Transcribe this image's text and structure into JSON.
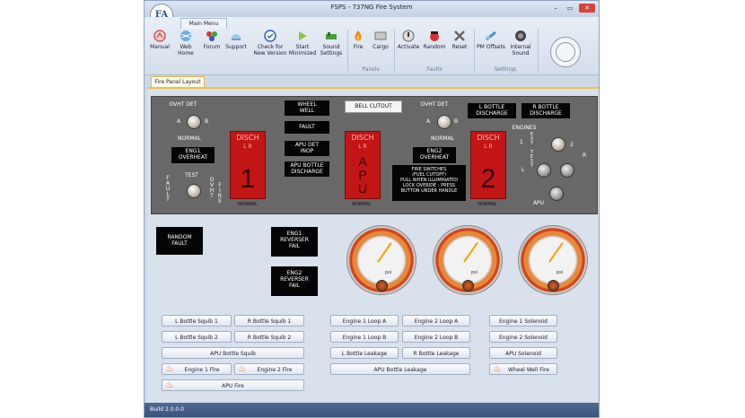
{
  "window": {
    "title": "FSPS - 737NG Fire System",
    "logo_text": "FA",
    "controls": {
      "minimize": "–",
      "maximize": "▭",
      "close": "✕"
    }
  },
  "ribbon": {
    "tab": "Main Menu",
    "buttons": [
      {
        "label": "Manual",
        "icon": "manual-icon"
      },
      {
        "label": "Web Home",
        "icon": "web-home-icon"
      },
      {
        "label": "Forum",
        "icon": "forum-icon"
      },
      {
        "label": "Support",
        "icon": "support-icon"
      },
      {
        "label": "Check for\nNew Version",
        "icon": "check-version-icon"
      },
      {
        "label": "Start\nMinimized",
        "icon": "start-minimized-icon"
      },
      {
        "label": "Sound\nSettings",
        "icon": "sound-settings-icon"
      },
      {
        "label": "Fire",
        "icon": "fire-icon"
      },
      {
        "label": "Cargo",
        "icon": "cargo-icon"
      },
      {
        "label": "Activate",
        "icon": "activate-icon"
      },
      {
        "label": "Random",
        "icon": "random-icon"
      },
      {
        "label": "Reset",
        "icon": "reset-icon"
      },
      {
        "label": "PM Offsets",
        "icon": "pm-offsets-icon"
      },
      {
        "label": "Internal\nSound",
        "icon": "internal-sound-icon"
      }
    ],
    "groups": {
      "panels": "Panels",
      "faults": "Faults",
      "settings": "Settings"
    }
  },
  "pane_tab": "Fire Panel Layout",
  "fire_panel": {
    "ovht_det_left": "OVHT DET",
    "a": "A",
    "b": "B",
    "normal_left": "NORMAL",
    "eng1_overheat": "ENG1\nOVERHEAT",
    "test": "TEST",
    "fault": "F\nA\nU\nL\nT",
    "ovht_vert": "O\nV\nH\nT",
    "fire_vert": "F\nI\nR\nE",
    "disch_label": "DISCH",
    "disch_sub": "L   R",
    "handle1": "1",
    "handle_apu": "A\nP\nU",
    "handle2": "2",
    "handle_normal": "NORMAL",
    "wheel_well": "WHEEL\nWELL",
    "fault_light": "FAULT",
    "apu_det_inop": "APU DET\nINOP",
    "apu_bottle_discharge": "APU BOTTLE\nDISCHARGE",
    "bell_cutout": "BELL CUTOUT",
    "ovht_det_right": "OVHT DET",
    "normal_right": "NORMAL",
    "eng2_overheat": "ENG2\nOVERHEAT",
    "fire_switch_info": "FIRE SWITCHES\n(FUEL CUTOFF)\nPULL WHEN ILLUMINATED\nLOCK OVERIDE : PRESS\nBUTTON UNDER HANDLE",
    "l_bottle_discharge": "L BOTTLE\nDISCHARGE",
    "r_bottle_discharge": "R BOTTLE\nDISCHARGE",
    "engines": "ENGINES",
    "ext_test": "E\nX\nT\n\nT\nE\nS\nT",
    "one": "1",
    "two": "2",
    "l": "L",
    "r": "R",
    "apu_label": "APU"
  },
  "faults": {
    "random_fault": "RANDOM\nFAULT",
    "eng1_reverser_fail": "ENG1\nREVERSER\nFAIL",
    "eng2_reverser_fail": "ENG2\nREVERSER\nFAIL"
  },
  "gauges": {
    "unit": "psi",
    "count": 3
  },
  "buttons": {
    "l_bottle_squib_1": "L Bottle Squib 1",
    "r_bottle_squib_1": "R Bottle Squib 1",
    "l_bottle_squib_2": "L Bottle Squib 2",
    "r_bottle_squib_2": "R Bottle Squib 2",
    "apu_bottle_squib": "APU Bottle Squib",
    "engine_1_fire": "Engine 1 Fire",
    "engine_2_fire": "Engine 2 Fire",
    "apu_fire": "APU Fire",
    "engine_1_loop_a": "Engine 1 Loop A",
    "engine_2_loop_a": "Engine 2 Loop A",
    "engine_1_loop_b": "Engine 1 Loop B",
    "engine_2_loop_b": "Engine 2 Loop B",
    "l_bottle_leakage": "L Bottle Leakage",
    "r_bottle_leakage": "R Bottle Leakage",
    "apu_bottle_leakage": "APU Bottle Leakage",
    "engine_1_solenoid": "Engine 1 Solenoid",
    "engine_2_solenoid": "Engine 2 Solenoid",
    "apu_solenoid": "APU Solenoid",
    "wheel_well_fire": "Wheel Well Fire"
  },
  "status_bar": {
    "build": "Build 2.0.0.0"
  },
  "colors": {
    "disch_red": "#c21515",
    "fire_orange": "#f26a0a",
    "status_bar": "#3f5a83",
    "panel_gray": "#686868"
  }
}
